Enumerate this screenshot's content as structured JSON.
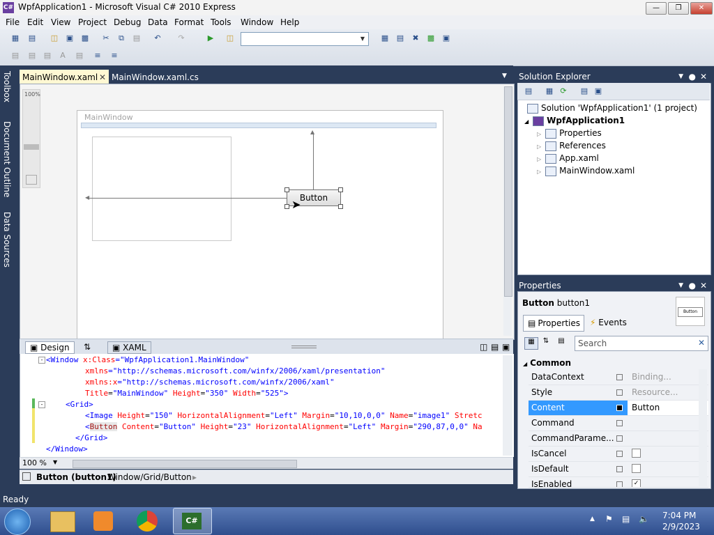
{
  "window": {
    "title": "WpfApplication1 - Microsoft Visual C# 2010 Express"
  },
  "menu": [
    "File",
    "Edit",
    "View",
    "Project",
    "Debug",
    "Data",
    "Format",
    "Tools",
    "Window",
    "Help"
  ],
  "side_tabs": [
    "Toolbox",
    "Document Outline",
    "Data Sources"
  ],
  "doc_tabs": {
    "active": "MainWindow.xaml",
    "inactive": "MainWindow.xaml.cs"
  },
  "designer": {
    "zoom_label": "100%",
    "window_title": "MainWindow",
    "button_label": "Button"
  },
  "view_tabs": {
    "design": "Design",
    "xaml": "XAML"
  },
  "xaml": {
    "line1": {
      "open": "<Window ",
      "attr": "x:Class",
      "eq": "=",
      "val": "\"WpfApplication1.MainWindow\""
    },
    "line2": {
      "attr": "xmlns",
      "eq": "=",
      "val": "\"http://schemas.microsoft.com/winfx/2006/xaml/presentation\""
    },
    "line3": {
      "attr": "xmlns:x",
      "eq": "=",
      "val": "\"http://schemas.microsoft.com/winfx/2006/xaml\""
    },
    "line4": {
      "a1": "Title",
      "v1": "\"MainWindow\"",
      "a2": "Height",
      "v2": "\"350\"",
      "a3": "Width",
      "v3": "\"525\"",
      "close": ">"
    },
    "line5": {
      "tag": "<Grid>"
    },
    "line6": {
      "open": "<Image ",
      "a1": "Height",
      "v1": "\"150\"",
      "a2": "HorizontalAlignment",
      "v2": "\"Left\"",
      "a3": "Margin",
      "v3": "\"10,10,0,0\"",
      "a4": "Name",
      "v4": "\"image1\"",
      "a5": "Stretc"
    },
    "line7": {
      "open": "<",
      "tag": "Button",
      "a1": "Content",
      "v1": "\"Button\"",
      "a2": "Height",
      "v2": "\"23\"",
      "a3": "HorizontalAlignment",
      "v3": "\"Left\"",
      "a4": "Margin",
      "v4": "\"290,87,0,0\"",
      "a5": "Na"
    },
    "line8": {
      "tag": "</Grid>"
    },
    "line9": {
      "tag": "</Window>"
    }
  },
  "zoom": "100 %",
  "breadcrumb": {
    "selected": "Button (button1)",
    "path": "Window/Grid/Button"
  },
  "solution_explorer": {
    "title": "Solution Explorer",
    "items": [
      {
        "label": "Solution 'WpfApplication1' (1 project)"
      },
      {
        "label": "WpfApplication1"
      },
      {
        "label": "Properties"
      },
      {
        "label": "References"
      },
      {
        "label": "App.xaml"
      },
      {
        "label": "MainWindow.xaml"
      }
    ]
  },
  "properties": {
    "title": "Properties",
    "type": "Button",
    "name": "button1",
    "preview": "Button",
    "tab_properties": "Properties",
    "tab_events": "Events",
    "search_placeholder": "Search",
    "category": "Common",
    "rows": [
      {
        "name": "DataContext",
        "value": "Binding..."
      },
      {
        "name": "Style",
        "value": "Resource..."
      },
      {
        "name": "Content",
        "value": "Button"
      },
      {
        "name": "Command",
        "value": ""
      },
      {
        "name": "CommandParame...",
        "value": ""
      },
      {
        "name": "IsCancel",
        "value": ""
      },
      {
        "name": "IsDefault",
        "value": ""
      },
      {
        "name": "IsEnabled",
        "value": ""
      }
    ],
    "isenabled_checked": true
  },
  "status": "Ready",
  "clock": {
    "time": "7:04 PM",
    "date": "2/9/2023"
  },
  "colors": {
    "ide_bg": "#2b3c59",
    "selection": "#3399ff",
    "tab_active": "#fff8d3"
  }
}
